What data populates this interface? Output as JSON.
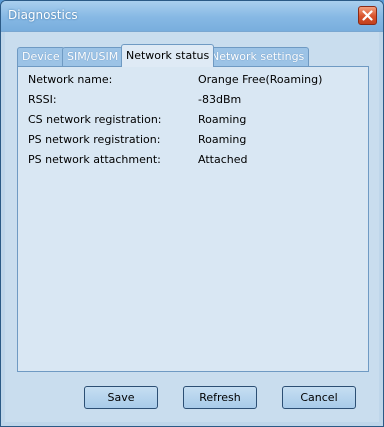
{
  "window": {
    "title": "Diagnostics"
  },
  "tabs": [
    {
      "label": "Device",
      "active": false
    },
    {
      "label": "SIM/USIM",
      "active": false
    },
    {
      "label": "Network status",
      "active": true
    },
    {
      "label": "Network settings",
      "active": false
    }
  ],
  "network_status": {
    "rows": [
      {
        "label": "Network name:",
        "value": "Orange Free(Roaming)"
      },
      {
        "label": "RSSI:",
        "value": "-83dBm"
      },
      {
        "label": "CS network registration:",
        "value": "Roaming"
      },
      {
        "label": "PS network registration:",
        "value": "Roaming"
      },
      {
        "label": "PS network attachment:",
        "value": "Attached"
      }
    ]
  },
  "buttons": {
    "save": "Save",
    "refresh": "Refresh",
    "cancel": "Cancel"
  },
  "icons": {
    "close": "close-icon"
  }
}
